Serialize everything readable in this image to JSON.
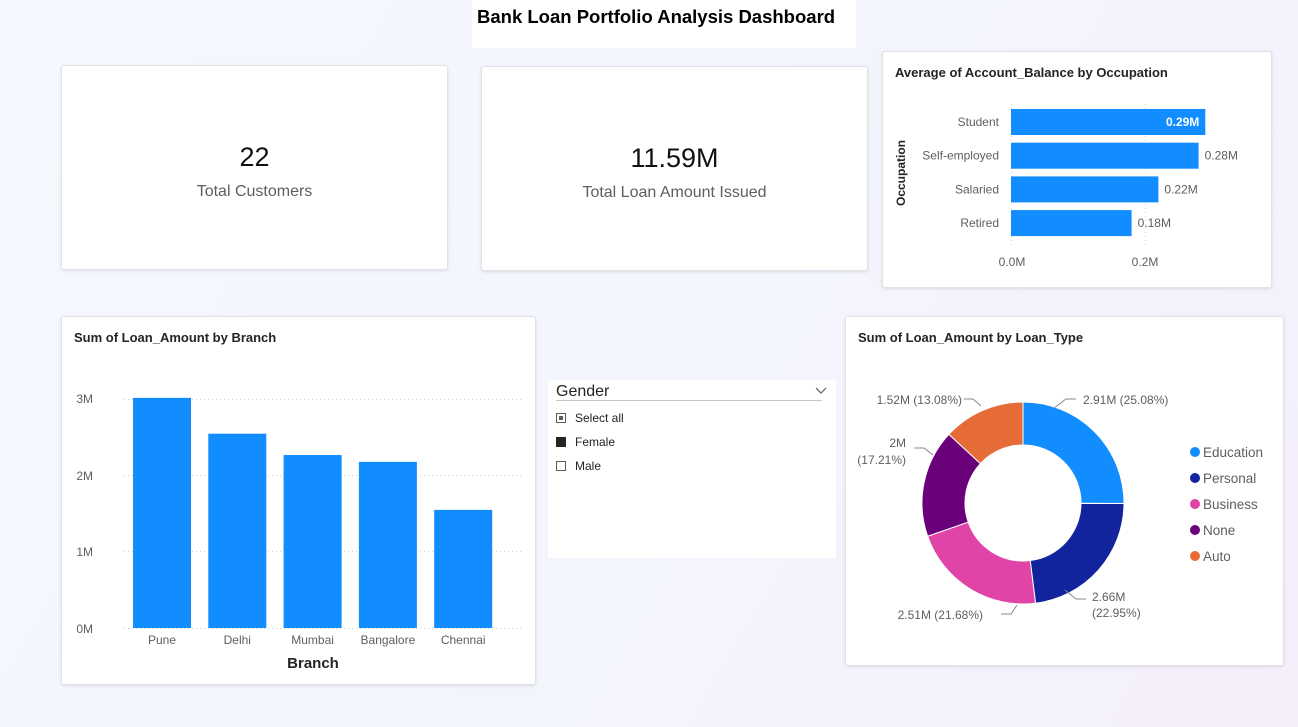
{
  "page": {
    "title": "Bank Loan Portfolio Analysis Dashboard"
  },
  "kpis": {
    "customers": {
      "value": "22",
      "label": "Total Customers"
    },
    "loan_total": {
      "value": "11.59M",
      "label": "Total Loan Amount Issued"
    }
  },
  "colors": {
    "bar": "#118dff",
    "education": "#118dff",
    "personal": "#12239e",
    "business": "#e044a7",
    "none": "#6b007b",
    "auto": "#e66c37"
  },
  "occupation_chart": {
    "title": "Average of Account_Balance by Occupation",
    "ylabel": "Occupation",
    "xticks": [
      "0.0M",
      "0.2M"
    ]
  },
  "branch_chart": {
    "title": "Sum of Loan_Amount by Branch",
    "xlabel": "Branch",
    "yticks": [
      "3M",
      "2M",
      "1M",
      "0M"
    ]
  },
  "loan_type_chart": {
    "title": "Sum of Loan_Amount by Loan_Type"
  },
  "slicer": {
    "title": "Gender",
    "items": [
      {
        "label": "Select all",
        "state": "partial"
      },
      {
        "label": "Female",
        "state": "checked"
      },
      {
        "label": "Male",
        "state": "unchecked"
      }
    ]
  },
  "chart_data": [
    {
      "type": "bar",
      "orientation": "horizontal",
      "title": "Average of Account_Balance by Occupation",
      "xlabel": "",
      "ylabel": "Occupation",
      "categories": [
        "Student",
        "Self-employed",
        "Salaried",
        "Retired"
      ],
      "values": [
        0.29,
        0.28,
        0.22,
        0.18
      ],
      "data_labels": [
        "0.29M",
        "0.28M",
        "0.22M",
        "0.18M"
      ],
      "unit": "M",
      "xlim": [
        0,
        0.29
      ],
      "grid": true
    },
    {
      "type": "bar",
      "title": "Sum of Loan_Amount by Branch",
      "xlabel": "Branch",
      "ylabel": "",
      "categories": [
        "Pune",
        "Delhi",
        "Mumbai",
        "Bangalore",
        "Chennai"
      ],
      "values": [
        3.02,
        2.55,
        2.27,
        2.18,
        1.55
      ],
      "unit": "M",
      "ylim": [
        0,
        3
      ],
      "grid": true
    },
    {
      "type": "pie",
      "variant": "donut",
      "title": "Sum of Loan_Amount by Loan_Type",
      "categories": [
        "Education",
        "Personal",
        "Business",
        "None",
        "Auto"
      ],
      "values": [
        2.91,
        2.66,
        2.51,
        2.0,
        1.52
      ],
      "percents": [
        25.08,
        22.95,
        21.68,
        17.21,
        13.08
      ],
      "slice_labels": [
        "2.91M (25.08%)",
        "2.66M",
        "2.51M (21.68%)",
        "2M",
        "1.52M (13.08%)"
      ],
      "slice_sublabels": [
        "",
        "(22.95%)",
        "",
        "(17.21%)",
        ""
      ],
      "legend_position": "right"
    }
  ]
}
